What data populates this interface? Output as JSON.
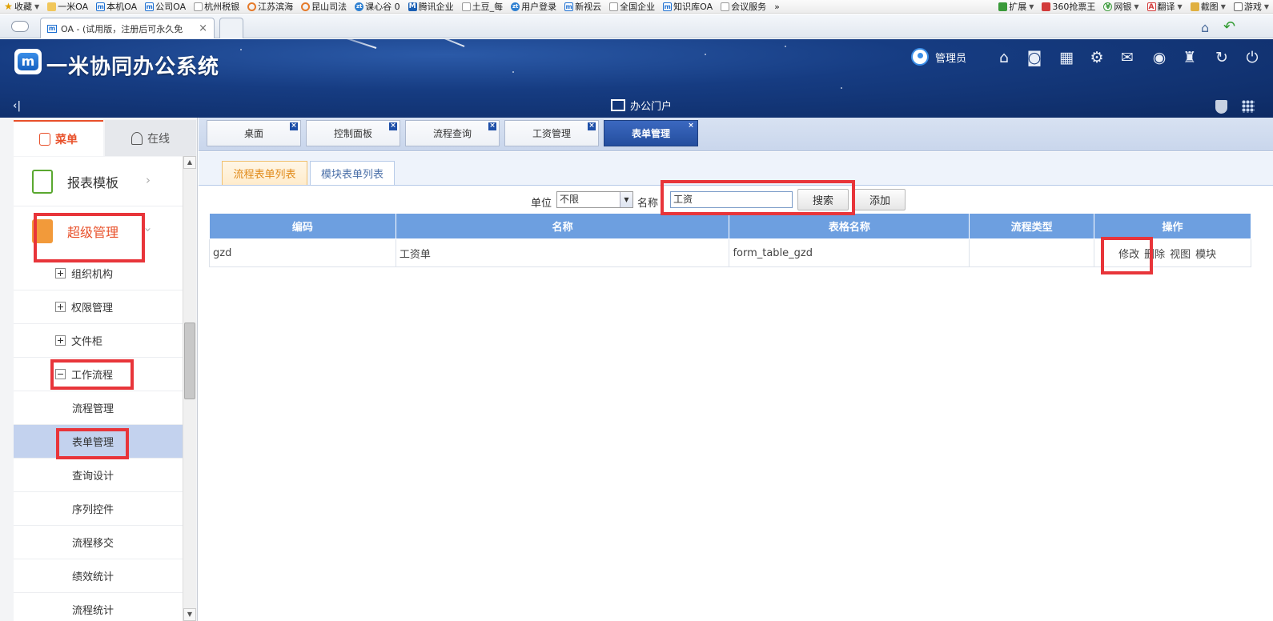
{
  "bookmarks": {
    "items": [
      {
        "label": "收藏",
        "icon": "star-icon"
      },
      {
        "label": "一米OA",
        "icon": "folder-icon"
      },
      {
        "label": "本机OA",
        "icon": "m-logo-icon"
      },
      {
        "label": "公司OA",
        "icon": "m-logo-icon"
      },
      {
        "label": "杭州税银",
        "icon": "page-icon"
      },
      {
        "label": "江苏滨海",
        "icon": "swirl-icon"
      },
      {
        "label": "昆山司法",
        "icon": "swirl-icon"
      },
      {
        "label": "课心谷 0",
        "icon": "zt-icon"
      },
      {
        "label": "腾讯企业",
        "icon": "tencent-icon"
      },
      {
        "label": "土豆_每",
        "icon": "page-icon"
      },
      {
        "label": "用户登录",
        "icon": "zt-icon"
      },
      {
        "label": "新视云",
        "icon": "m-logo-icon"
      },
      {
        "label": "全国企业",
        "icon": "page-icon"
      },
      {
        "label": "知识库OA",
        "icon": "m-logo-icon"
      },
      {
        "label": "会议服务",
        "icon": "page-icon"
      }
    ],
    "more": "»",
    "right_items": [
      {
        "label": "扩展",
        "icon": "extension-icon"
      },
      {
        "label": "360抢票王",
        "icon": "360-icon"
      },
      {
        "label": "网银",
        "icon": "yen-icon"
      },
      {
        "label": "翻译",
        "icon": "translate-icon"
      },
      {
        "label": "截图",
        "icon": "scissors-icon"
      },
      {
        "label": "游戏",
        "icon": "game-icon"
      }
    ]
  },
  "browser": {
    "tab_logo": "m",
    "tab_title": "OA - (试用版，注册后可永久免",
    "tab_close": "×"
  },
  "header": {
    "logo_letter": "m",
    "app_title": "一米协同办公系统",
    "user_name": "管理员",
    "portal_label": "办公门户",
    "collapse_glyph": "‹|"
  },
  "sidebar": {
    "tabs": {
      "menu": "菜单",
      "online": "在线"
    },
    "groups": {
      "report": "报表模板",
      "super": "超级管理"
    },
    "chevron": "›",
    "items": [
      {
        "label": "组织机构",
        "type": "plus"
      },
      {
        "label": "权限管理",
        "type": "plus"
      },
      {
        "label": "文件柜",
        "type": "plus"
      },
      {
        "label": "工作流程",
        "type": "minus"
      },
      {
        "label": "流程管理",
        "type": "leaf"
      },
      {
        "label": "表单管理",
        "type": "leaf",
        "active": true
      },
      {
        "label": "查询设计",
        "type": "leaf"
      },
      {
        "label": "序列控件",
        "type": "leaf"
      },
      {
        "label": "流程移交",
        "type": "leaf"
      },
      {
        "label": "绩效统计",
        "type": "leaf"
      },
      {
        "label": "流程统计",
        "type": "leaf"
      }
    ]
  },
  "main_tabs": [
    {
      "label": "桌面",
      "active": false
    },
    {
      "label": "控制面板",
      "active": false
    },
    {
      "label": "流程查询",
      "active": false
    },
    {
      "label": "工资管理",
      "active": false
    },
    {
      "label": "表单管理",
      "active": true
    }
  ],
  "sub_tabs": {
    "flow_forms": "流程表单列表",
    "module_forms": "模块表单列表"
  },
  "search": {
    "unit_label": "单位",
    "unit_value": "不限",
    "name_label": "名称",
    "name_value": "工资",
    "search_button": "搜索",
    "add_button": "添加"
  },
  "table": {
    "headers": [
      "编码",
      "名称",
      "表格名称",
      "流程类型",
      "操作"
    ],
    "rows": [
      {
        "code": "gzd",
        "name": "工资单",
        "table_name": "form_table_gzd",
        "flow_type": "",
        "ops": [
          "修改",
          "删除",
          "视图",
          "模块"
        ]
      }
    ]
  },
  "colors": {
    "accent_orange": "#e8502a",
    "header_blue": "#163c82",
    "table_header": "#6d9fe0",
    "highlight_red": "#e8353a",
    "active_tab": "#2d5cb0"
  }
}
